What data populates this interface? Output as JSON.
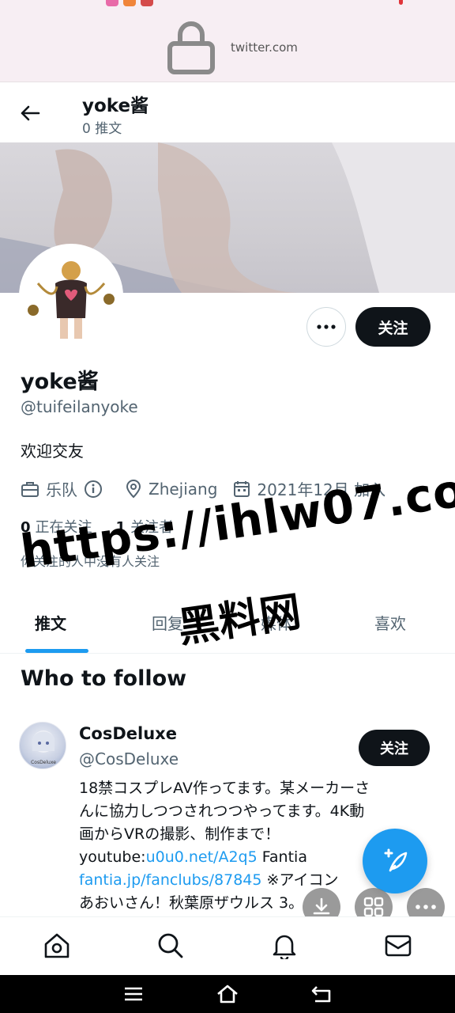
{
  "browser": {
    "url": "twitter.com"
  },
  "header": {
    "name": "yoke酱",
    "post_count": "0 推文"
  },
  "profile": {
    "name": "yoke酱",
    "handle": "@tuifeilanyoke",
    "bio": "欢迎交友",
    "category": "乐队",
    "location": "Zhejiang",
    "joined": "2021年12月 加入",
    "following_count": "0",
    "following_label": "正在关注",
    "followers_count": "1",
    "followers_label": "关注者",
    "mutuals_note": "你关注的人中没有人关注",
    "follow_label": "关注"
  },
  "tabs": [
    {
      "label": "推文"
    },
    {
      "label": "回复"
    },
    {
      "label": "媒体"
    },
    {
      "label": "喜欢"
    }
  ],
  "watermark": {
    "url": "https://ihlw07.com",
    "name": "黑料网"
  },
  "who_to_follow": {
    "title": "Who to follow",
    "suggestion": {
      "name": "CosDeluxe",
      "handle": "@CosDeluxe",
      "avatar_caption": "CosDeluxe",
      "follow_label": "关注",
      "bio_line1": "18禁コスプレAV作ってます。某メーカーさ",
      "bio_line2": "んに協力しつつされつつやってます。4K動",
      "bio_line3": "画からVRの撮影、制作まで！",
      "bio_prefix4": "youtube:",
      "bio_link1": "u0u0.net/A2q5",
      "bio_suffix4": " Fantia",
      "bio_link2": "fantia.jp/fanclubs/87845",
      "bio_suffix5": " ※アイコン",
      "bio_line6": "あおいさん！秋葉原ザウルス 3。"
    }
  },
  "colors": {
    "accent": "#1d9bf0",
    "text": "#0f1419",
    "muted": "#536471"
  },
  "icons": [
    "lock-icon",
    "back-arrow-icon",
    "more-icon",
    "briefcase-icon",
    "info-icon",
    "location-icon",
    "calendar-icon",
    "compose-icon",
    "download-icon",
    "grid-icon",
    "home-icon",
    "search-icon",
    "notifications-icon",
    "messages-icon"
  ]
}
